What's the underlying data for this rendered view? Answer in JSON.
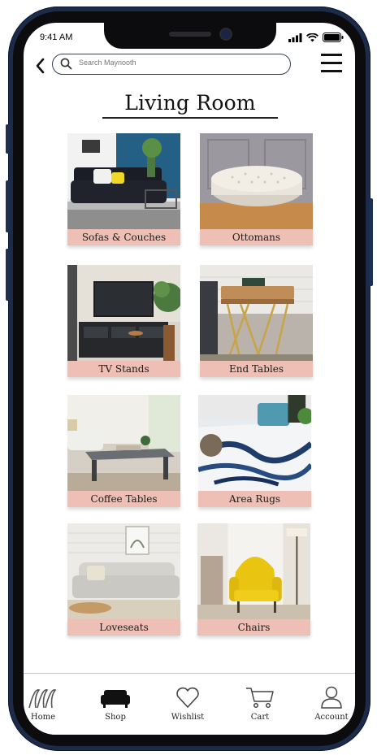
{
  "status_bar": {
    "time": "9:41 AM"
  },
  "search": {
    "placeholder": "Search Maynooth"
  },
  "page": {
    "title": "Living Room"
  },
  "categories": [
    {
      "label": "Sofas & Couches"
    },
    {
      "label": "Ottomans"
    },
    {
      "label": "TV Stands"
    },
    {
      "label": "End Tables"
    },
    {
      "label": "Coffee Tables"
    },
    {
      "label": "Area Rugs"
    },
    {
      "label": "Loveseats"
    },
    {
      "label": "Chairs"
    }
  ],
  "tabbar": {
    "home": "Home",
    "shop": "Shop",
    "wishlist": "Wishlist",
    "cart": "Cart",
    "account": "Account"
  },
  "colors": {
    "frame": "#1c2b4a",
    "label_bg": "#ebb4a8",
    "accent": "#33415a"
  }
}
